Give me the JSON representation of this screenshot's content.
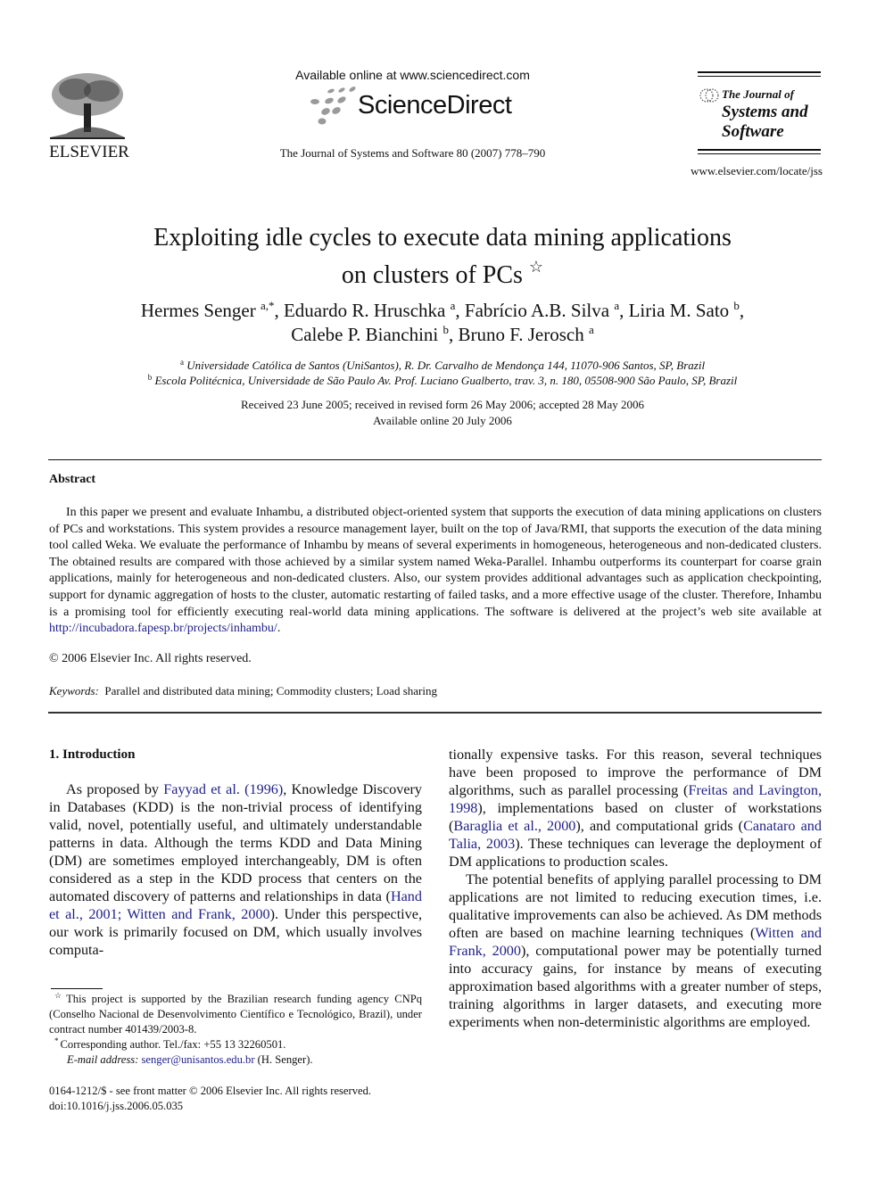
{
  "header": {
    "publisher_wordmark": "ELSEVIER",
    "available_online": "Available online at www.sciencedirect.com",
    "sciencedirect_wordmark": "ScienceDirect",
    "journal_reference": "The Journal of Systems and Software 80 (2007) 778–790",
    "journal_logo_line1": "The Journal of",
    "journal_logo_line2": "Systems and",
    "journal_logo_line3": "Software",
    "journal_url": "www.elsevier.com/locate/jss"
  },
  "article": {
    "title_line1": "Exploiting idle cycles to execute data mining applications",
    "title_line2": "on clusters of PCs",
    "title_note_mark": "☆",
    "authors": [
      {
        "name": "Hermes Senger",
        "affil": "a,*",
        "sep": ", "
      },
      {
        "name": "Eduardo R. Hruschka",
        "affil": "a",
        "sep": ", "
      },
      {
        "name": "Fabrício A.B. Silva",
        "affil": "a",
        "sep": ", "
      },
      {
        "name": "Liria M. Sato",
        "affil": "b",
        "sep": ","
      },
      {
        "name": "Calebe P. Bianchini",
        "affil": "b",
        "sep": ", "
      },
      {
        "name": "Bruno F. Jerosch",
        "affil": "a",
        "sep": ""
      }
    ],
    "affiliations": [
      {
        "mark": "a",
        "text": "Universidade Católica de Santos (UniSantos), R. Dr. Carvalho de Mendonça 144, 11070-906 Santos, SP, Brazil"
      },
      {
        "mark": "b",
        "text": "Escola Politécnica, Universidade de São Paulo Av. Prof. Luciano Gualberto, trav. 3, n. 180, 05508-900 São Paulo, SP, Brazil"
      }
    ],
    "dates_line1": "Received 23 June 2005; received in revised form 26 May 2006; accepted 28 May 2006",
    "dates_line2": "Available online 20 July 2006"
  },
  "abstract": {
    "heading": "Abstract",
    "text": "In this paper we present and evaluate Inhambu, a distributed object-oriented system that supports the execution of data mining applications on clusters of PCs and workstations. This system provides a resource management layer, built on the top of Java/RMI, that supports the execution of the data mining tool called Weka. We evaluate the performance of Inhambu by means of several experiments in homogeneous, heterogeneous and non-dedicated clusters. The obtained results are compared with those achieved by a similar system named Weka-Parallel. Inhambu outperforms its counterpart for coarse grain applications, mainly for heterogeneous and non-dedicated clusters. Also, our system provides additional advantages such as application checkpointing, support for dynamic aggregation of hosts to the cluster, automatic restarting of failed tasks, and a more effective usage of the cluster. Therefore, Inhambu is a promising tool for efficiently executing real-world data mining applications. The software is delivered at the project’s web site available at ",
    "link": "http://incubadora.fapesp.br/projects/inhambu/",
    "link_end": ".",
    "copyright": "© 2006 Elsevier Inc. All rights reserved.",
    "keywords_label": "Keywords:",
    "keywords": "Parallel and distributed data mining; Commodity clusters; Load sharing"
  },
  "body": {
    "section_heading": "1. Introduction",
    "left_p1": [
      {
        "t": "As proposed by "
      },
      {
        "t": "Fayyad et al. (1996)",
        "link": true
      },
      {
        "t": ", Knowledge Discovery in Databases (KDD) is the non-trivial process of identifying valid, novel, potentially useful, and ultimately understandable patterns in data. Although the terms KDD and Data Mining (DM) are sometimes employed interchangeably, DM is often considered as a step in the KDD process that centers on the automated discovery of patterns and relationships in data ("
      },
      {
        "t": "Hand et al., 2001; Witten and Frank, 2000",
        "link": true
      },
      {
        "t": "). Under this perspective, our work is primarily focused on DM, which usually involves computa-"
      }
    ],
    "right_p1": [
      {
        "t": "tionally expensive tasks. For this reason, several techniques have been proposed to improve the performance of DM algorithms, such as parallel processing ("
      },
      {
        "t": "Freitas and Lavington, 1998",
        "link": true
      },
      {
        "t": "), implementations based on cluster of workstations ("
      },
      {
        "t": "Baraglia et al., 2000",
        "link": true
      },
      {
        "t": "), and computational grids ("
      },
      {
        "t": "Canataro and Talia, 2003",
        "link": true
      },
      {
        "t": "). These techniques can leverage the deployment of DM applications to production scales."
      }
    ],
    "right_p2": [
      {
        "t": "The potential benefits of applying parallel processing to DM applications are not limited to reducing execution times, i.e. qualitative improvements can also be achieved. As DM methods often are based on machine learning techniques ("
      },
      {
        "t": "Witten and Frank, 2000",
        "link": true
      },
      {
        "t": "), computational power may be potentially turned into accuracy gains, for instance by means of executing approximation based algorithms with a greater number of steps, training algorithms in larger datasets, and executing more experiments when non-deterministic algorithms are employed."
      }
    ]
  },
  "footnotes": {
    "star_mark": "☆",
    "star_text": "This project is supported by the Brazilian research funding agency CNPq (Conselho Nacional de Desenvolvimento Científico e Tecnológico, Brazil), under contract number 401439/2003-8.",
    "corr_mark": "*",
    "corr_text": "Corresponding author. Tel./fax: +55 13 32260501.",
    "email_label": "E-mail address:",
    "email": "senger@unisantos.edu.br",
    "email_suffix": " (H. Senger).",
    "front_matter": "0164-1212/$ - see front matter © 2006 Elsevier Inc. All rights reserved.",
    "doi": "doi:10.1016/j.jss.2006.05.035"
  },
  "colors": {
    "text": "#111111",
    "link": "#1f1f8a"
  }
}
